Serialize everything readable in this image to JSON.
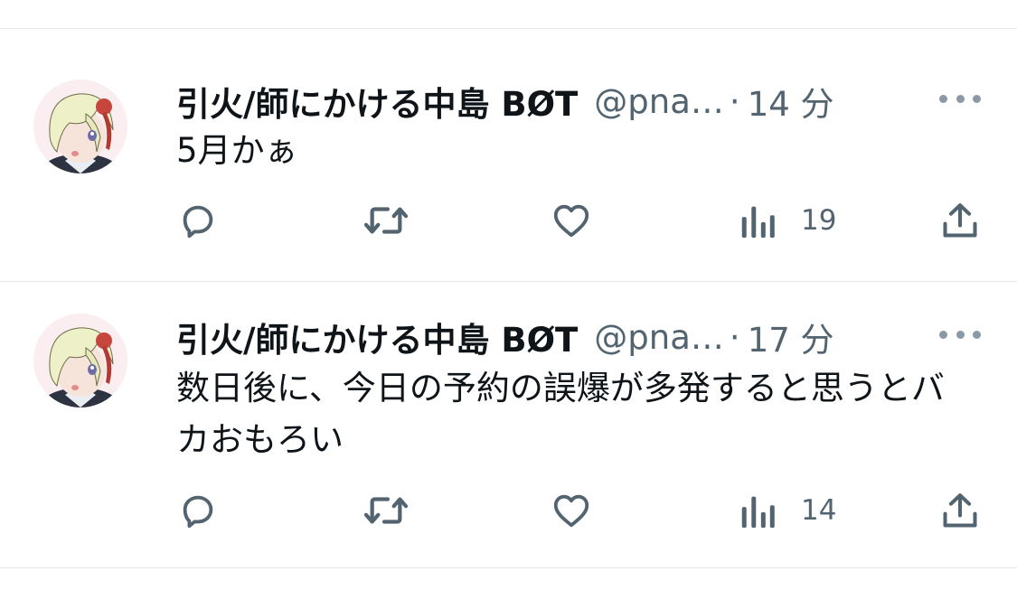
{
  "tweets": [
    {
      "author_name": "引火/師にかける中島 BØT",
      "handle": "@pna…",
      "separator": "·",
      "time": "14 分",
      "text": "5月かぁ",
      "views": "19"
    },
    {
      "author_name": "引火/師にかける中島 BØT",
      "handle": "@pna…",
      "separator": "·",
      "time": "17 分",
      "text": "数日後に、今日の予約の誤爆が多発すると思うとバカおもろい",
      "views": "14"
    }
  ],
  "icons": {
    "reply": "reply-icon",
    "retweet": "retweet-icon",
    "like": "heart-icon",
    "views": "views-icon",
    "share": "share-icon",
    "more": "more-icon"
  },
  "colors": {
    "text": "#0f1419",
    "secondary": "#536471",
    "divider": "#e3e6ea"
  }
}
